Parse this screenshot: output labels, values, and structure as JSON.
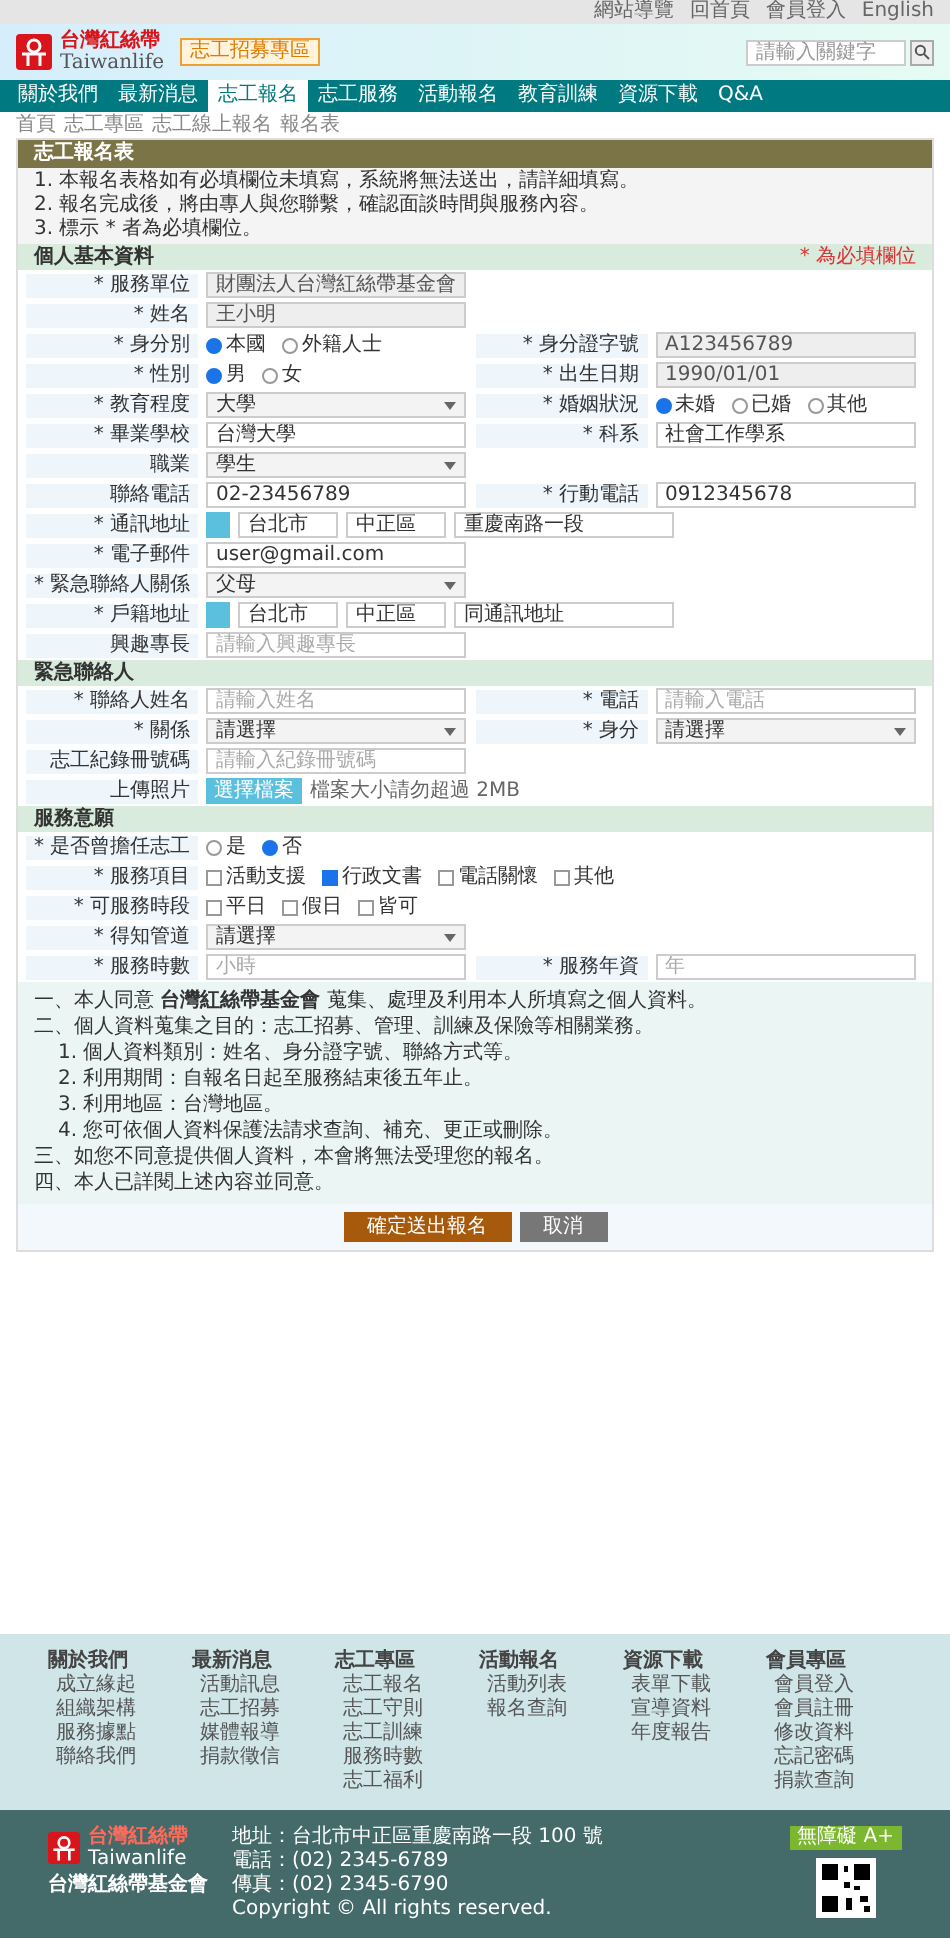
{
  "top_links": [
    "網站導覽",
    "回首頁",
    "會員登入",
    "English"
  ],
  "logo": {
    "name": "台灣紅絲帶",
    "en": "Taiwanlife",
    "tag": "志工招募專區"
  },
  "search": {
    "placeholder": "請輸入關鍵字"
  },
  "nav": [
    {
      "label": "關於我們",
      "selected": false
    },
    {
      "label": "最新消息",
      "selected": false
    },
    {
      "label": "志工報名",
      "selected": true
    },
    {
      "label": "志工服務",
      "selected": false
    },
    {
      "label": "活動報名",
      "selected": false
    },
    {
      "label": "教育訓練",
      "selected": false
    },
    {
      "label": "資源下載",
      "selected": false
    },
    {
      "label": "Q&A",
      "selected": false
    }
  ],
  "breadcrumb": [
    "首頁",
    "志工專區",
    "志工線上報名",
    "報名表"
  ],
  "panel": {
    "title": "志工報名表",
    "intro": [
      "1. 本報名表格如有必填欄位未填寫，系統將無法送出，請詳細填寫。",
      "2. 報名完成後，將由專人與您聯繫，確認面談時間與服務內容。",
      "3. 標示 * 者為必填欄位。"
    ],
    "sections": [
      {
        "title": "個人基本資料",
        "aside": "* 為必填欄位",
        "rows": [
          [
            {
              "label": "* 服務單位",
              "kind": "text",
              "value": "財團法人台灣紅絲帶基金會",
              "disabled": true
            }
          ],
          [
            {
              "label": "* 姓名",
              "kind": "text",
              "value": "王小明",
              "disabled": true
            }
          ],
          [
            {
              "label": "* 身分別",
              "kind": "radio",
              "options": [
                {
                  "label": "本國",
                  "selected": true
                },
                {
                  "label": "外籍人士",
                  "selected": false
                }
              ]
            },
            {
              "label": "* 身分證字號",
              "kind": "text",
              "value": "A123456789",
              "disabled": true
            }
          ],
          [
            {
              "label": "* 性別",
              "kind": "radio",
              "options": [
                {
                  "label": "男",
                  "selected": true
                },
                {
                  "label": "女",
                  "selected": false
                }
              ]
            },
            {
              "label": "* 出生日期",
              "kind": "text",
              "value": "1990/01/01",
              "disabled": true
            }
          ],
          [
            {
              "label": "* 教育程度",
              "kind": "select",
              "value": "大學"
            },
            {
              "label": "* 婚姻狀況",
              "kind": "radio",
              "options": [
                {
                  "label": "未婚",
                  "selected": true
                },
                {
                  "label": "已婚",
                  "selected": false
                },
                {
                  "label": "其他",
                  "selected": false
                }
              ]
            }
          ],
          [
            {
              "label": "* 畢業學校",
              "kind": "text",
              "value": "台灣大學"
            },
            {
              "label": "* 科系",
              "kind": "text",
              "value": "社會工作學系"
            }
          ],
          [
            {
              "label": "職業",
              "kind": "select",
              "value": "學生"
            }
          ],
          [
            {
              "label": "聯絡電話",
              "kind": "text",
              "value": "02-23456789"
            },
            {
              "label": "* 行動電話",
              "kind": "text",
              "value": "0912345678"
            }
          ],
          [
            {
              "label": "* 通訊地址",
              "kind": "address",
              "city": "台北市",
              "district": "中正區",
              "value": "重慶南路一段"
            }
          ],
          [
            {
              "label": "* 電子郵件",
              "kind": "text",
              "value": "user@gmail.com"
            }
          ],
          [
            {
              "label": "* 緊急聯絡人關係",
              "kind": "select",
              "value": "父母"
            }
          ],
          [
            {
              "label": "* 戶籍地址",
              "kind": "address",
              "city": "台北市",
              "district": "中正區",
              "value": "同通訊地址"
            }
          ],
          [
            {
              "label": "興趣專長",
              "kind": "text",
              "placeholder": "請輸入興趣專長"
            }
          ]
        ]
      },
      {
        "title": "緊急聯絡人",
        "rows": [
          [
            {
              "label": "* 聯絡人姓名",
              "kind": "text",
              "placeholder": "請輸入姓名"
            },
            {
              "label": "* 電話",
              "kind": "text",
              "placeholder": "請輸入電話"
            }
          ],
          [
            {
              "label": "* 關係",
              "kind": "select",
              "value": "請選擇"
            },
            {
              "label": "* 身分",
              "kind": "select",
              "value": "請選擇"
            }
          ],
          [
            {
              "label": "志工紀錄冊號碼",
              "kind": "text",
              "placeholder": "請輸入紀錄冊號碼"
            }
          ],
          [
            {
              "label": "上傳照片",
              "kind": "file",
              "button": "選擇檔案",
              "hint": "檔案大小請勿超過 2MB"
            }
          ]
        ]
      },
      {
        "title": "服務意願",
        "rows": [
          [
            {
              "label": "* 是否曾擔任志工",
              "kind": "radio",
              "options": [
                {
                  "label": "是",
                  "selected": false
                },
                {
                  "label": "否",
                  "selected": true
                }
              ]
            }
          ],
          [
            {
              "label": "* 服務項目",
              "kind": "checks",
              "options": [
                {
                  "label": "活動支援",
                  "checked": false
                },
                {
                  "label": "行政文書",
                  "checked": true
                },
                {
                  "label": "電話關懷",
                  "checked": false
                },
                {
                  "label": "其他",
                  "checked": false
                }
              ]
            }
          ],
          [
            {
              "label": "* 可服務時段",
              "kind": "checks",
              "options": [
                {
                  "label": "平日",
                  "checked": false
                },
                {
                  "label": "假日",
                  "checked": false
                },
                {
                  "label": "皆可",
                  "checked": false
                }
              ]
            }
          ],
          [
            {
              "label": "* 得知管道",
              "kind": "select",
              "value": "請選擇"
            }
          ],
          [
            {
              "label": "* 服務時數",
              "kind": "text",
              "placeholder": "小時"
            },
            {
              "label": "* 服務年資",
              "kind": "text",
              "placeholder": "年"
            }
          ]
        ]
      }
    ],
    "notes": [
      {
        "kind": "note",
        "text": "一、本人同意 **台灣紅絲帶基金會** 蒐集、處理及利用本人所填寫之個人資料。"
      },
      {
        "kind": "note",
        "text": "二、個人資料蒐集之目的：志工招募、管理、訓練及保險等相關業務。"
      },
      {
        "kind": "item",
        "text": "1. 個人資料類別：姓名、身分證字號、聯絡方式等。"
      },
      {
        "kind": "item",
        "text": "2. 利用期間：自報名日起至服務結束後五年止。"
      },
      {
        "kind": "item",
        "text": "3. 利用地區：台灣地區。"
      },
      {
        "kind": "item",
        "text": "4. 您可依個人資料保護法請求查詢、補充、更正或刪除。"
      },
      {
        "kind": "note",
        "text": "三、如您不同意提供個人資料，本會將無法受理您的報名。"
      },
      {
        "kind": "note",
        "text": "四、本人已詳閱上述內容並同意。"
      }
    ],
    "buttons": [
      {
        "label": "確定送出報名",
        "kind": "primary"
      },
      {
        "label": "取消",
        "kind": "secondary"
      }
    ]
  },
  "footer": {
    "columns": [
      {
        "title": "關於我們",
        "links": [
          "成立緣起",
          "組織架構",
          "服務據點",
          "聯絡我們"
        ]
      },
      {
        "title": "最新消息",
        "links": [
          "活動訊息",
          "志工招募",
          "媒體報導",
          "捐款徵信"
        ]
      },
      {
        "title": "志工專區",
        "links": [
          "志工報名",
          "志工守則",
          "志工訓練",
          "服務時數",
          "志工福利"
        ]
      },
      {
        "title": "活動報名",
        "links": [
          "活動列表",
          "報名查詢"
        ]
      },
      {
        "title": "資源下載",
        "links": [
          "表單下載",
          "宣導資料",
          "年度報告"
        ]
      },
      {
        "title": "會員專區",
        "links": [
          "會員登入",
          "會員註冊",
          "修改資料",
          "忘記密碼",
          "捐款查詢"
        ]
      }
    ],
    "org": {
      "name": "台灣紅絲帶",
      "en": "Taiwanlife",
      "sub": "台灣紅絲帶基金會"
    },
    "contact": [
      "地址：台北市中正區重慶南路一段 100 號",
      "電話：(02) 2345-6789",
      "傳真：(02) 2345-6790"
    ],
    "copyright": "Copyright © All rights reserved.",
    "badge": "無障礙 A+"
  }
}
